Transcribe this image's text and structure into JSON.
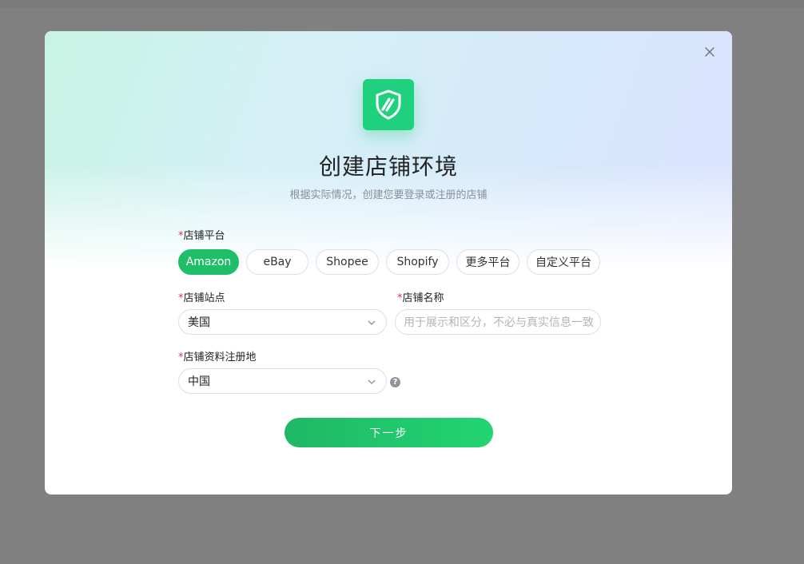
{
  "dialog": {
    "title": "创建店铺环境",
    "subtitle": "根据实际情况，创建您要登录或注册的店铺"
  },
  "platform": {
    "label": "店铺平台",
    "required_mark": "*",
    "options": [
      "Amazon",
      "eBay",
      "Shopee",
      "Shopify",
      "更多平台",
      "自定义平台"
    ],
    "selected": "Amazon"
  },
  "site": {
    "label": "店铺站点",
    "required_mark": "*",
    "value": "美国"
  },
  "store_name": {
    "label": "店铺名称",
    "required_mark": "*",
    "placeholder": "用于展示和区分，不必与真实信息一致"
  },
  "registration": {
    "label": "店铺资料注册地",
    "required_mark": "*",
    "value": "中国",
    "help_icon": "?"
  },
  "actions": {
    "next_label": "下一步"
  },
  "icons": {
    "close": "close-icon",
    "logo": "shield-logo-icon",
    "chevron": "chevron-down-icon",
    "help": "question-circle-icon"
  },
  "colors": {
    "accent": "#1fbf6a",
    "logo_bg": "#1fd17c",
    "required": "#e0344a",
    "overlay": "#808080"
  }
}
